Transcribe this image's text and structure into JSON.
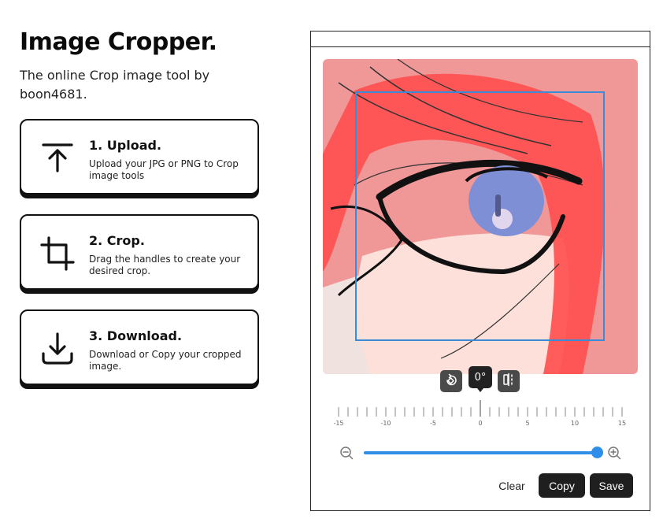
{
  "header": {
    "title": "Image Cropper.",
    "subtitle": "The online Crop image tool by boon4681."
  },
  "steps": [
    {
      "icon": "upload-icon",
      "title": "1. Upload.",
      "desc": "Upload your JPG or PNG to Crop image tools"
    },
    {
      "icon": "crop-icon",
      "title": "2. Crop.",
      "desc": "Drag the handles to create your desired crop."
    },
    {
      "icon": "download-icon",
      "title": "3. Download.",
      "desc": "Download or Copy your cropped image."
    }
  ],
  "editor": {
    "rotation": {
      "value_label": "0°",
      "value": 0,
      "min": -15,
      "max": 15
    },
    "ruler_labels": [
      "-15",
      "-10",
      "-5",
      "0",
      "5",
      "10",
      "15"
    ],
    "zoom": {
      "level": 1.0,
      "minus_icon": "zoom-out-icon",
      "plus_icon": "zoom-in-icon"
    },
    "tools": {
      "rotate_icon": "rotate-icon",
      "flip_icon": "flip-icon"
    },
    "actions": {
      "clear": "Clear",
      "copy": "Copy",
      "save": "Save"
    }
  },
  "colors": {
    "accent": "#2e8ee8",
    "crop_border": "#3a8bd8",
    "button_dark": "#1f1f1f"
  }
}
